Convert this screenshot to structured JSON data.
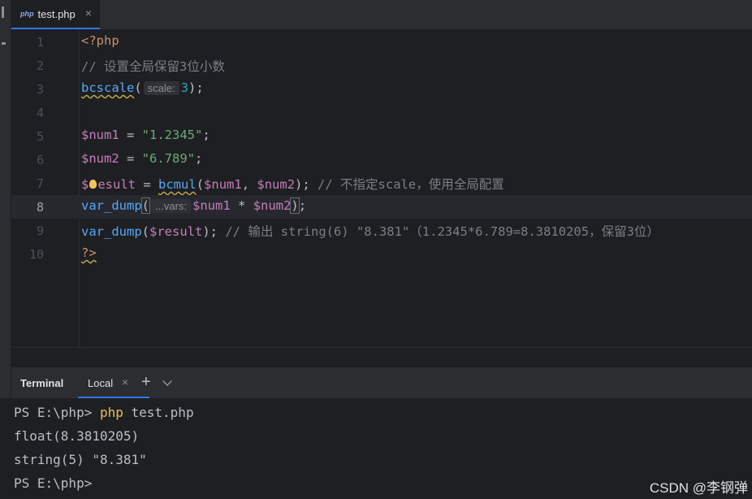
{
  "tab": {
    "icon": "php-file-icon",
    "icon_text": "php",
    "label": "test.php",
    "close": "×"
  },
  "editor": {
    "lines": [
      {
        "n": "1"
      },
      {
        "n": "2"
      },
      {
        "n": "3"
      },
      {
        "n": "4"
      },
      {
        "n": "5"
      },
      {
        "n": "6"
      },
      {
        "n": "7"
      },
      {
        "n": "8"
      },
      {
        "n": "9"
      },
      {
        "n": "10"
      }
    ],
    "current_line": "8",
    "code": {
      "l1": "<?php",
      "l2": "// 设置全局保留3位小数",
      "l3_fn": "bcscale",
      "l3_hint": "scale:",
      "l3_num": "3",
      "l5_var": "$num1",
      "l5_str": "\"1.2345\"",
      "l6_var": "$num2",
      "l6_str": "\"6.789\"",
      "l7_var_a": "$",
      "l7_var_b": "esult",
      "l7_fn": "bcmul",
      "l7_arg1": "$num1",
      "l7_arg2": "$num2",
      "l7_cm": "// 不指定scale，使用全局配置",
      "l8_fn": "var_dump",
      "l8_hint": "...vars:",
      "l8_arg1": "$num1",
      "l8_arg2": "$num2",
      "l9_fn": "var_dump",
      "l9_arg": "$result",
      "l9_cm": "// 输出 string(6) \"8.381\"（1.2345*6.789=8.3810205，保留3位）",
      "l10": "?>"
    }
  },
  "terminal": {
    "title": "Terminal",
    "tab_label": "Local",
    "tab_close": "×",
    "add": "+",
    "lines": {
      "l1_prompt": "PS E:\\php> ",
      "l1_cmd": "php",
      "l1_rest": " test.php",
      "l2": "float(8.3810205)",
      "l3": "string(5) \"8.381\"",
      "l4": "PS E:\\php>"
    }
  },
  "watermark": "CSDN @李钢弹"
}
